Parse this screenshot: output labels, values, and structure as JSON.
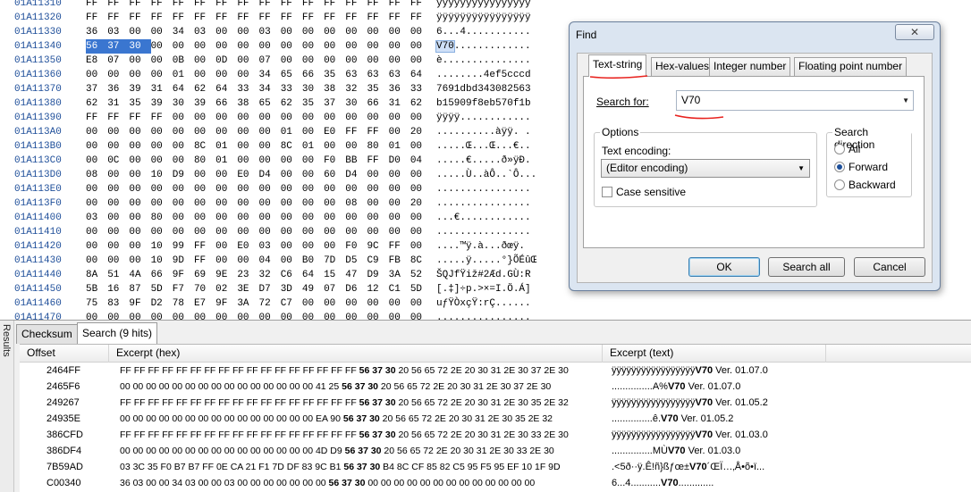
{
  "hex_rows": [
    {
      "offset": "01A11310",
      "bytes": [
        "FF",
        "FF",
        "FF",
        "FF",
        "FF",
        "FF",
        "FF",
        "FF",
        "FF",
        "FF",
        "FF",
        "FF",
        "FF",
        "FF",
        "FF",
        "FF"
      ],
      "ascii": "ÿÿÿÿÿÿÿÿÿÿÿÿÿÿÿÿ"
    },
    {
      "offset": "01A11320",
      "bytes": [
        "FF",
        "FF",
        "FF",
        "FF",
        "FF",
        "FF",
        "FF",
        "FF",
        "FF",
        "FF",
        "FF",
        "FF",
        "FF",
        "FF",
        "FF",
        "FF"
      ],
      "ascii": "ÿÿÿÿÿÿÿÿÿÿÿÿÿÿÿÿ"
    },
    {
      "offset": "01A11330",
      "bytes": [
        "36",
        "03",
        "00",
        "00",
        "34",
        "03",
        "00",
        "00",
        "03",
        "00",
        "00",
        "00",
        "00",
        "00",
        "00",
        "00"
      ],
      "ascii": "6...4..........."
    },
    {
      "offset": "01A11340",
      "bytes": [
        "56",
        "37",
        "30",
        "00",
        "00",
        "00",
        "00",
        "00",
        "00",
        "00",
        "00",
        "00",
        "00",
        "00",
        "00",
        "00"
      ],
      "ascii": "V70.............",
      "selected_bytes": 3,
      "ascii_selected": "V70",
      "ascii_rest": "............."
    },
    {
      "offset": "01A11350",
      "bytes": [
        "E8",
        "07",
        "00",
        "00",
        "0B",
        "00",
        "0D",
        "00",
        "07",
        "00",
        "00",
        "00",
        "00",
        "00",
        "00",
        "00"
      ],
      "ascii": "è..............."
    },
    {
      "offset": "01A11360",
      "bytes": [
        "00",
        "00",
        "00",
        "00",
        "01",
        "00",
        "00",
        "00",
        "34",
        "65",
        "66",
        "35",
        "63",
        "63",
        "63",
        "64"
      ],
      "ascii": "........4ef5cccd"
    },
    {
      "offset": "01A11370",
      "bytes": [
        "37",
        "36",
        "39",
        "31",
        "64",
        "62",
        "64",
        "33",
        "34",
        "33",
        "30",
        "38",
        "32",
        "35",
        "36",
        "33"
      ],
      "ascii": "7691dbd343082563"
    },
    {
      "offset": "01A11380",
      "bytes": [
        "62",
        "31",
        "35",
        "39",
        "30",
        "39",
        "66",
        "38",
        "65",
        "62",
        "35",
        "37",
        "30",
        "66",
        "31",
        "62"
      ],
      "ascii": "b15909f8eb570f1b"
    },
    {
      "offset": "01A11390",
      "bytes": [
        "FF",
        "FF",
        "FF",
        "FF",
        "00",
        "00",
        "00",
        "00",
        "00",
        "00",
        "00",
        "00",
        "00",
        "00",
        "00",
        "00"
      ],
      "ascii": "ÿÿÿÿ............"
    },
    {
      "offset": "01A113A0",
      "bytes": [
        "00",
        "00",
        "00",
        "00",
        "00",
        "00",
        "00",
        "00",
        "00",
        "01",
        "00",
        "E0",
        "FF",
        "FF",
        "00",
        "20"
      ],
      "ascii": "..........àÿÿ. ."
    },
    {
      "offset": "01A113B0",
      "bytes": [
        "00",
        "00",
        "00",
        "00",
        "00",
        "8C",
        "01",
        "00",
        "00",
        "8C",
        "01",
        "00",
        "00",
        "80",
        "01",
        "00"
      ],
      "ascii": ".....Œ...Œ...€.."
    },
    {
      "offset": "01A113C0",
      "bytes": [
        "00",
        "0C",
        "00",
        "00",
        "00",
        "80",
        "01",
        "00",
        "00",
        "00",
        "00",
        "F0",
        "BB",
        "FF",
        "D0",
        "04"
      ],
      "ascii": ".....€.....ð»ÿÐ."
    },
    {
      "offset": "01A113D0",
      "bytes": [
        "08",
        "00",
        "00",
        "10",
        "D9",
        "00",
        "00",
        "E0",
        "D4",
        "00",
        "00",
        "60",
        "D4",
        "00",
        "00",
        "00"
      ],
      "ascii": ".....Ù..àÔ..`Ô..."
    },
    {
      "offset": "01A113E0",
      "bytes": [
        "00",
        "00",
        "00",
        "00",
        "00",
        "00",
        "00",
        "00",
        "00",
        "00",
        "00",
        "00",
        "00",
        "00",
        "00",
        "00"
      ],
      "ascii": "................"
    },
    {
      "offset": "01A113F0",
      "bytes": [
        "00",
        "00",
        "00",
        "00",
        "00",
        "00",
        "00",
        "00",
        "00",
        "00",
        "00",
        "00",
        "08",
        "00",
        "00",
        "20"
      ],
      "ascii": "................"
    },
    {
      "offset": "01A11400",
      "bytes": [
        "03",
        "00",
        "00",
        "80",
        "00",
        "00",
        "00",
        "00",
        "00",
        "00",
        "00",
        "00",
        "00",
        "00",
        "00",
        "00"
      ],
      "ascii": "...€............"
    },
    {
      "offset": "01A11410",
      "bytes": [
        "00",
        "00",
        "00",
        "00",
        "00",
        "00",
        "00",
        "00",
        "00",
        "00",
        "00",
        "00",
        "00",
        "00",
        "00",
        "00"
      ],
      "ascii": "................"
    },
    {
      "offset": "01A11420",
      "bytes": [
        "00",
        "00",
        "00",
        "10",
        "99",
        "FF",
        "00",
        "E0",
        "03",
        "00",
        "00",
        "00",
        "F0",
        "9C",
        "FF",
        "00",
        "20"
      ],
      "ascii": "....™ÿ.à...ðœÿ."
    },
    {
      "offset": "01A11430",
      "bytes": [
        "00",
        "00",
        "00",
        "10",
        "9D",
        "FF",
        "00",
        "00",
        "04",
        "00",
        "B0",
        "7D",
        "D5",
        "C9",
        "FB",
        "8C"
      ],
      "ascii": ".....ÿ.....°}ÕÉûŒ"
    },
    {
      "offset": "01A11440",
      "bytes": [
        "8A",
        "51",
        "4A",
        "66",
        "9F",
        "69",
        "9E",
        "23",
        "32",
        "C6",
        "64",
        "15",
        "47",
        "D9",
        "3A",
        "52"
      ],
      "ascii": "ŠQJfŸiž#2Æd.GÙ:R"
    },
    {
      "offset": "01A11450",
      "bytes": [
        "5B",
        "16",
        "87",
        "5D",
        "F7",
        "70",
        "02",
        "3E",
        "D7",
        "3D",
        "49",
        "07",
        "D6",
        "12",
        "C1",
        "5D"
      ],
      "ascii": "[.‡]÷p.>×=I.Ö.Á]"
    },
    {
      "offset": "01A11460",
      "bytes": [
        "75",
        "83",
        "9F",
        "D2",
        "78",
        "E7",
        "9F",
        "3A",
        "72",
        "C7",
        "00",
        "00",
        "00",
        "00",
        "00",
        "00"
      ],
      "ascii": "uƒŸÒxçŸ:rÇ......"
    },
    {
      "offset": "01A11470",
      "bytes": [
        "00",
        "00",
        "00",
        "00",
        "00",
        "00",
        "00",
        "00",
        "00",
        "00",
        "00",
        "00",
        "00",
        "00",
        "00",
        "00"
      ],
      "ascii": "................"
    }
  ],
  "find_dialog": {
    "title": "Find",
    "close_label": "✕",
    "tabs": [
      "Text-string",
      "Hex-values",
      "Integer number",
      "Floating point number"
    ],
    "active_tab": 0,
    "search_for_label": "Search for:",
    "search_value": "V70",
    "options_label": "Options",
    "encoding_label": "Text encoding:",
    "encoding_value": "(Editor encoding)",
    "case_sensitive_label": "Case sensitive",
    "case_sensitive_checked": false,
    "direction_label": "Search direction",
    "directions": [
      "All",
      "Forward",
      "Backward"
    ],
    "direction_selected": 1,
    "ok_label": "OK",
    "search_all_label": "Search all",
    "cancel_label": "Cancel",
    "annotation_color": "#e8231f"
  },
  "results_panel": {
    "sidebar_label": "Results",
    "tabs": [
      "Checksum",
      "Search (9 hits)"
    ],
    "active_tab": 1,
    "columns": [
      "Offset",
      "Excerpt (hex)",
      "Excerpt (text)"
    ],
    "rows": [
      {
        "offset": "2464FF",
        "hex_pre": "FF FF FF FF FF FF FF FF FF FF FF FF FF FF FF FF FF ",
        "hex_hit": "56 37 30",
        "hex_post": " 20 56 65 72 2E 20 30 31 2E 30 37 2E 30",
        "text_pre": "ÿÿÿÿÿÿÿÿÿÿÿÿÿÿÿÿÿ",
        "text_hit": "V70",
        "text_post": " Ver. 01.07.0"
      },
      {
        "offset": "2465F6",
        "hex_pre": "00 00 00 00 00 00 00 00 00 00 00 00 00 00 00 41 25 ",
        "hex_hit": "56 37 30",
        "hex_post": " 20 56 65 72 2E 20 30 31 2E 30 37 2E 30",
        "text_pre": "...............A%",
        "text_hit": "V70",
        "text_post": " Ver. 01.07.0"
      },
      {
        "offset": "249267",
        "hex_pre": "FF FF FF FF FF FF FF FF FF FF FF FF FF FF FF FF FF ",
        "hex_hit": "56 37 30",
        "hex_post": " 20 56 65 72 2E 20 30 31 2E 30 35 2E 32",
        "text_pre": "ÿÿÿÿÿÿÿÿÿÿÿÿÿÿÿÿÿ",
        "text_hit": "V70",
        "text_post": " Ver. 01.05.2"
      },
      {
        "offset": "24935E",
        "hex_pre": "00 00 00 00 00 00 00 00 00 00 00 00 00 00 00 EA 90 ",
        "hex_hit": "56 37 30",
        "hex_post": " 20 56 65 72 2E 20 30 31 2E 30 35 2E 32",
        "text_pre": "...............ê.",
        "text_hit": "V70",
        "text_post": " Ver. 01.05.2"
      },
      {
        "offset": "386CFD",
        "hex_pre": "FF FF FF FF FF FF FF FF FF FF FF FF FF FF FF FF FF ",
        "hex_hit": "56 37 30",
        "hex_post": " 20 56 65 72 2E 20 30 31 2E 30 33 2E 30",
        "text_pre": "ÿÿÿÿÿÿÿÿÿÿÿÿÿÿÿÿÿ",
        "text_hit": "V70",
        "text_post": " Ver. 01.03.0"
      },
      {
        "offset": "386DF4",
        "hex_pre": "00 00 00 00 00 00 00 00 00 00 00 00 00 00 00 4D D9 ",
        "hex_hit": "56 37 30",
        "hex_post": " 20 56 65 72 2E 20 30 31 2E 30 33 2E 30",
        "text_pre": "...............MÙ",
        "text_hit": "V70",
        "text_post": " Ver. 01.03.0"
      },
      {
        "offset": "7B59AD",
        "hex_pre": "03 3C 35 F0 B7 B7 FF 0E CA 21 F1 7D DF 83 9C B1 ",
        "hex_hit": "56 37 30",
        "hex_post": " B4 8C CF 85 82 C5 95 F5 95 EF 10 1F 9D",
        "text_pre": ".<5ð··ÿ.Ê!ñ}ßƒœ±",
        "text_hit": "V70",
        "text_post": "´ŒÏ…‚Å•õ•ï..."
      },
      {
        "offset": "C00340",
        "hex_pre": "36 03 00 00 34 03 00 00 03 00 00 00 00 00 00 00 ",
        "hex_hit": "56 37 30",
        "hex_post": " 00 00 00 00 00 00 00 00 00 00 00 00 00",
        "text_pre": "6...4...........",
        "text_hit": "V70",
        "text_post": "............."
      }
    ]
  }
}
